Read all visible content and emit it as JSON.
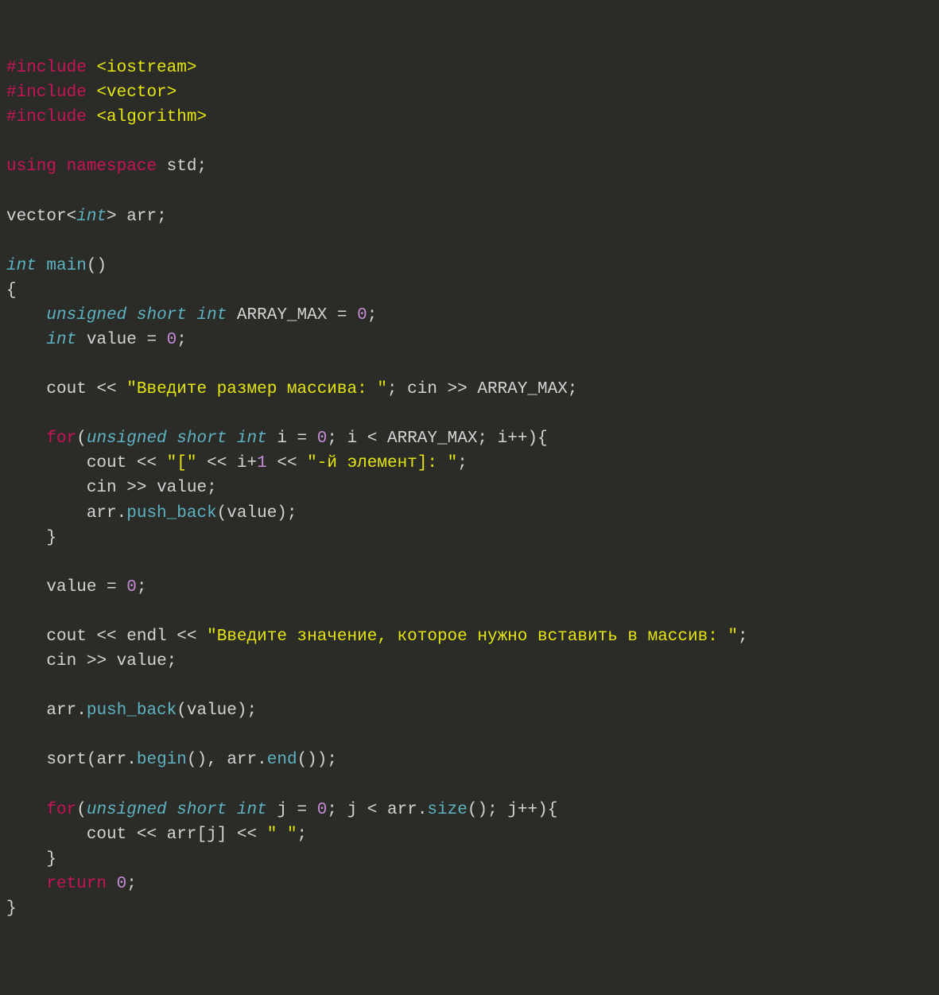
{
  "code": {
    "lines": [
      [
        {
          "cls": "c-pre",
          "t": "#include"
        },
        {
          "cls": "c-op",
          "t": " "
        },
        {
          "cls": "c-ang",
          "t": "<iostream>"
        }
      ],
      [
        {
          "cls": "c-pre",
          "t": "#include"
        },
        {
          "cls": "c-op",
          "t": " "
        },
        {
          "cls": "c-ang",
          "t": "<vector>"
        }
      ],
      [
        {
          "cls": "c-pre",
          "t": "#include"
        },
        {
          "cls": "c-op",
          "t": " "
        },
        {
          "cls": "c-ang",
          "t": "<algorithm>"
        }
      ],
      [],
      [
        {
          "cls": "c-kw",
          "t": "using"
        },
        {
          "cls": "c-op",
          "t": " "
        },
        {
          "cls": "c-kw",
          "t": "namespace"
        },
        {
          "cls": "c-op",
          "t": " "
        },
        {
          "cls": "c-ident",
          "t": "std"
        },
        {
          "cls": "c-punc",
          "t": ";"
        }
      ],
      [],
      [
        {
          "cls": "c-ident",
          "t": "vector"
        },
        {
          "cls": "c-punc",
          "t": "<"
        },
        {
          "cls": "c-type",
          "t": "int"
        },
        {
          "cls": "c-punc",
          "t": ">"
        },
        {
          "cls": "c-op",
          "t": " "
        },
        {
          "cls": "c-ident",
          "t": "arr"
        },
        {
          "cls": "c-punc",
          "t": ";"
        }
      ],
      [],
      [
        {
          "cls": "c-type",
          "t": "int"
        },
        {
          "cls": "c-op",
          "t": " "
        },
        {
          "cls": "c-func",
          "t": "main"
        },
        {
          "cls": "c-punc",
          "t": "()"
        }
      ],
      [
        {
          "cls": "c-punc",
          "t": "{"
        }
      ],
      [
        {
          "cls": "c-op",
          "t": "    "
        },
        {
          "cls": "c-type",
          "t": "unsigned"
        },
        {
          "cls": "c-op",
          "t": " "
        },
        {
          "cls": "c-type",
          "t": "short"
        },
        {
          "cls": "c-op",
          "t": " "
        },
        {
          "cls": "c-type",
          "t": "int"
        },
        {
          "cls": "c-op",
          "t": " "
        },
        {
          "cls": "c-ident",
          "t": "ARRAY_MAX"
        },
        {
          "cls": "c-op",
          "t": " = "
        },
        {
          "cls": "c-num",
          "t": "0"
        },
        {
          "cls": "c-punc",
          "t": ";"
        }
      ],
      [
        {
          "cls": "c-op",
          "t": "    "
        },
        {
          "cls": "c-type",
          "t": "int"
        },
        {
          "cls": "c-op",
          "t": " "
        },
        {
          "cls": "c-ident",
          "t": "value"
        },
        {
          "cls": "c-op",
          "t": " = "
        },
        {
          "cls": "c-num",
          "t": "0"
        },
        {
          "cls": "c-punc",
          "t": ";"
        }
      ],
      [],
      [
        {
          "cls": "c-op",
          "t": "    "
        },
        {
          "cls": "c-ident",
          "t": "cout"
        },
        {
          "cls": "c-op",
          "t": " << "
        },
        {
          "cls": "c-str",
          "t": "\"Введите размер массива: \""
        },
        {
          "cls": "c-punc",
          "t": ";"
        },
        {
          "cls": "c-op",
          "t": " "
        },
        {
          "cls": "c-ident",
          "t": "cin"
        },
        {
          "cls": "c-op",
          "t": " >> "
        },
        {
          "cls": "c-ident",
          "t": "ARRAY_MAX"
        },
        {
          "cls": "c-punc",
          "t": ";"
        }
      ],
      [],
      [
        {
          "cls": "c-op",
          "t": "    "
        },
        {
          "cls": "c-kw",
          "t": "for"
        },
        {
          "cls": "c-punc",
          "t": "("
        },
        {
          "cls": "c-type",
          "t": "unsigned"
        },
        {
          "cls": "c-op",
          "t": " "
        },
        {
          "cls": "c-type",
          "t": "short"
        },
        {
          "cls": "c-op",
          "t": " "
        },
        {
          "cls": "c-type",
          "t": "int"
        },
        {
          "cls": "c-op",
          "t": " "
        },
        {
          "cls": "c-ident",
          "t": "i"
        },
        {
          "cls": "c-op",
          "t": " = "
        },
        {
          "cls": "c-num",
          "t": "0"
        },
        {
          "cls": "c-punc",
          "t": ";"
        },
        {
          "cls": "c-op",
          "t": " "
        },
        {
          "cls": "c-ident",
          "t": "i"
        },
        {
          "cls": "c-op",
          "t": " < "
        },
        {
          "cls": "c-ident",
          "t": "ARRAY_MAX"
        },
        {
          "cls": "c-punc",
          "t": ";"
        },
        {
          "cls": "c-op",
          "t": " "
        },
        {
          "cls": "c-ident",
          "t": "i"
        },
        {
          "cls": "c-op",
          "t": "++"
        },
        {
          "cls": "c-punc",
          "t": "){"
        }
      ],
      [
        {
          "cls": "c-op",
          "t": "        "
        },
        {
          "cls": "c-ident",
          "t": "cout"
        },
        {
          "cls": "c-op",
          "t": " << "
        },
        {
          "cls": "c-str",
          "t": "\"[\""
        },
        {
          "cls": "c-op",
          "t": " << "
        },
        {
          "cls": "c-ident",
          "t": "i"
        },
        {
          "cls": "c-op",
          "t": "+"
        },
        {
          "cls": "c-num",
          "t": "1"
        },
        {
          "cls": "c-op",
          "t": " << "
        },
        {
          "cls": "c-str",
          "t": "\"-й элемент]: \""
        },
        {
          "cls": "c-punc",
          "t": ";"
        }
      ],
      [
        {
          "cls": "c-op",
          "t": "        "
        },
        {
          "cls": "c-ident",
          "t": "cin"
        },
        {
          "cls": "c-op",
          "t": " >> "
        },
        {
          "cls": "c-ident",
          "t": "value"
        },
        {
          "cls": "c-punc",
          "t": ";"
        }
      ],
      [
        {
          "cls": "c-op",
          "t": "        "
        },
        {
          "cls": "c-ident",
          "t": "arr"
        },
        {
          "cls": "c-punc",
          "t": "."
        },
        {
          "cls": "c-func",
          "t": "push_back"
        },
        {
          "cls": "c-punc",
          "t": "("
        },
        {
          "cls": "c-ident",
          "t": "value"
        },
        {
          "cls": "c-punc",
          "t": ");"
        }
      ],
      [
        {
          "cls": "c-op",
          "t": "    "
        },
        {
          "cls": "c-punc",
          "t": "}"
        }
      ],
      [],
      [
        {
          "cls": "c-op",
          "t": "    "
        },
        {
          "cls": "c-ident",
          "t": "value"
        },
        {
          "cls": "c-op",
          "t": " = "
        },
        {
          "cls": "c-num",
          "t": "0"
        },
        {
          "cls": "c-punc",
          "t": ";"
        }
      ],
      [],
      [
        {
          "cls": "c-op",
          "t": "    "
        },
        {
          "cls": "c-ident",
          "t": "cout"
        },
        {
          "cls": "c-op",
          "t": " << "
        },
        {
          "cls": "c-ident",
          "t": "endl"
        },
        {
          "cls": "c-op",
          "t": " << "
        },
        {
          "cls": "c-str",
          "t": "\"Введите значение, которое нужно вставить в массив: \""
        },
        {
          "cls": "c-punc",
          "t": ";"
        }
      ],
      [
        {
          "cls": "c-op",
          "t": "    "
        },
        {
          "cls": "c-ident",
          "t": "cin"
        },
        {
          "cls": "c-op",
          "t": " >> "
        },
        {
          "cls": "c-ident",
          "t": "value"
        },
        {
          "cls": "c-punc",
          "t": ";"
        }
      ],
      [],
      [
        {
          "cls": "c-op",
          "t": "    "
        },
        {
          "cls": "c-ident",
          "t": "arr"
        },
        {
          "cls": "c-punc",
          "t": "."
        },
        {
          "cls": "c-func",
          "t": "push_back"
        },
        {
          "cls": "c-punc",
          "t": "("
        },
        {
          "cls": "c-ident",
          "t": "value"
        },
        {
          "cls": "c-punc",
          "t": ");"
        }
      ],
      [],
      [
        {
          "cls": "c-op",
          "t": "    "
        },
        {
          "cls": "c-ident",
          "t": "sort"
        },
        {
          "cls": "c-punc",
          "t": "("
        },
        {
          "cls": "c-ident",
          "t": "arr"
        },
        {
          "cls": "c-punc",
          "t": "."
        },
        {
          "cls": "c-func",
          "t": "begin"
        },
        {
          "cls": "c-punc",
          "t": "()"
        },
        {
          "cls": "c-punc",
          "t": ","
        },
        {
          "cls": "c-op",
          "t": " "
        },
        {
          "cls": "c-ident",
          "t": "arr"
        },
        {
          "cls": "c-punc",
          "t": "."
        },
        {
          "cls": "c-func",
          "t": "end"
        },
        {
          "cls": "c-punc",
          "t": "()"
        },
        {
          "cls": "c-punc",
          "t": ");"
        }
      ],
      [],
      [
        {
          "cls": "c-op",
          "t": "    "
        },
        {
          "cls": "c-kw",
          "t": "for"
        },
        {
          "cls": "c-punc",
          "t": "("
        },
        {
          "cls": "c-type",
          "t": "unsigned"
        },
        {
          "cls": "c-op",
          "t": " "
        },
        {
          "cls": "c-type",
          "t": "short"
        },
        {
          "cls": "c-op",
          "t": " "
        },
        {
          "cls": "c-type",
          "t": "int"
        },
        {
          "cls": "c-op",
          "t": " "
        },
        {
          "cls": "c-ident",
          "t": "j"
        },
        {
          "cls": "c-op",
          "t": " = "
        },
        {
          "cls": "c-num",
          "t": "0"
        },
        {
          "cls": "c-punc",
          "t": ";"
        },
        {
          "cls": "c-op",
          "t": " "
        },
        {
          "cls": "c-ident",
          "t": "j"
        },
        {
          "cls": "c-op",
          "t": " < "
        },
        {
          "cls": "c-ident",
          "t": "arr"
        },
        {
          "cls": "c-punc",
          "t": "."
        },
        {
          "cls": "c-func",
          "t": "size"
        },
        {
          "cls": "c-punc",
          "t": "()"
        },
        {
          "cls": "c-punc",
          "t": ";"
        },
        {
          "cls": "c-op",
          "t": " "
        },
        {
          "cls": "c-ident",
          "t": "j"
        },
        {
          "cls": "c-op",
          "t": "++"
        },
        {
          "cls": "c-punc",
          "t": "){"
        }
      ],
      [
        {
          "cls": "c-op",
          "t": "        "
        },
        {
          "cls": "c-ident",
          "t": "cout"
        },
        {
          "cls": "c-op",
          "t": " << "
        },
        {
          "cls": "c-ident",
          "t": "arr"
        },
        {
          "cls": "c-punc",
          "t": "["
        },
        {
          "cls": "c-ident",
          "t": "j"
        },
        {
          "cls": "c-punc",
          "t": "]"
        },
        {
          "cls": "c-op",
          "t": " << "
        },
        {
          "cls": "c-str",
          "t": "\" \""
        },
        {
          "cls": "c-punc",
          "t": ";"
        }
      ],
      [
        {
          "cls": "c-op",
          "t": "    "
        },
        {
          "cls": "c-punc",
          "t": "}"
        }
      ],
      [
        {
          "cls": "c-op",
          "t": "    "
        },
        {
          "cls": "c-kw",
          "t": "return"
        },
        {
          "cls": "c-op",
          "t": " "
        },
        {
          "cls": "c-num",
          "t": "0"
        },
        {
          "cls": "c-punc",
          "t": ";"
        }
      ],
      [
        {
          "cls": "c-punc",
          "t": "}"
        }
      ]
    ]
  }
}
